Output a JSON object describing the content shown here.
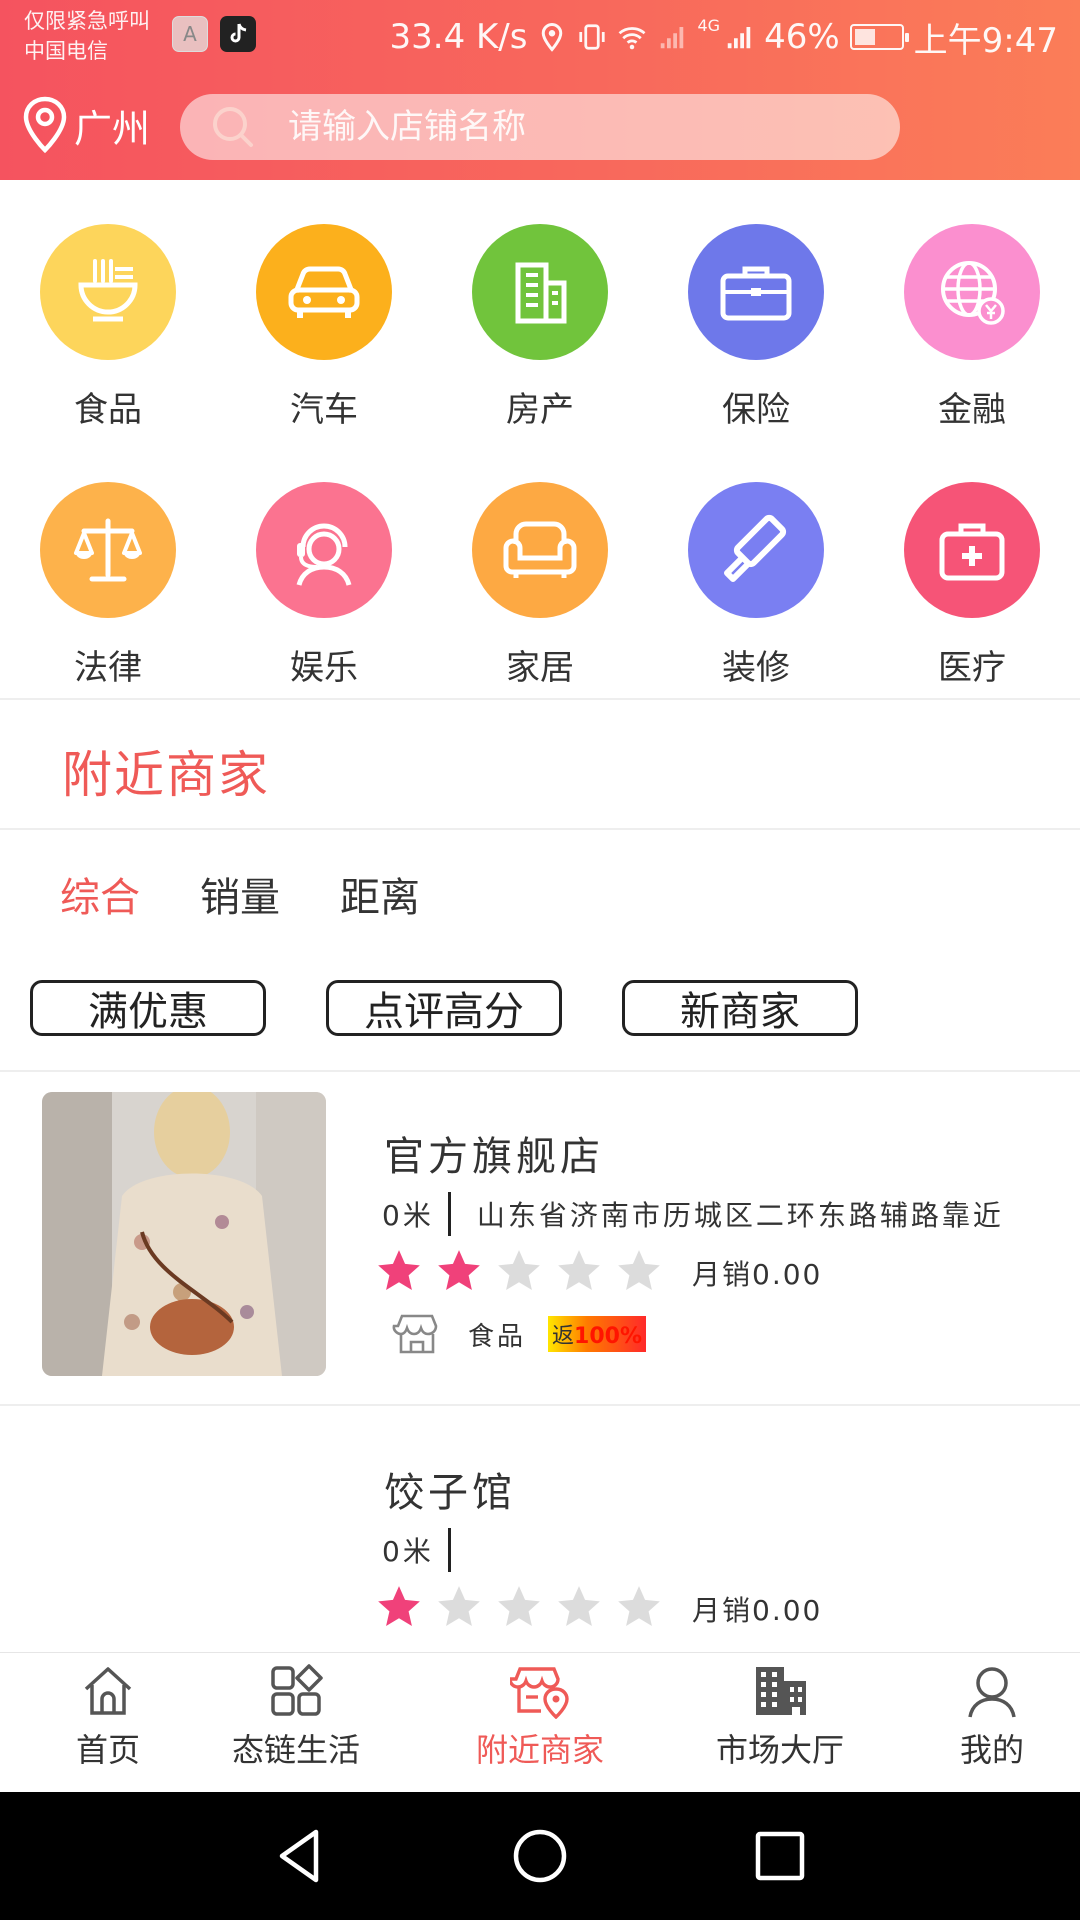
{
  "status_bar": {
    "notice": "仅限紧急呼叫",
    "carrier": "中国电信",
    "app_a": "A",
    "app_tiktok_icon": "tiktok-icon",
    "speed": "33.4 K/s",
    "network": "4G",
    "battery": "46%",
    "battery_level": 0.46,
    "time": "上午9:47"
  },
  "header": {
    "city": "广州",
    "search_placeholder": "请输入店铺名称",
    "gradient": [
      "#f5535f",
      "#fb7d58"
    ]
  },
  "categories": [
    {
      "label": "食品",
      "color": "#fdd55b",
      "icon": "noodle-bowl-icon"
    },
    {
      "label": "汽车",
      "color": "#fcb01c",
      "icon": "car-icon"
    },
    {
      "label": "房产",
      "color": "#71c43c",
      "icon": "building-icon"
    },
    {
      "label": "保险",
      "color": "#6e78ea",
      "icon": "briefcase-icon"
    },
    {
      "label": "金融",
      "color": "#fb8fcf",
      "icon": "globe-yen-icon"
    },
    {
      "label": "法律",
      "color": "#fdb24b",
      "icon": "scales-icon"
    },
    {
      "label": "娱乐",
      "color": "#fb7390",
      "icon": "headset-user-icon"
    },
    {
      "label": "家居",
      "color": "#fda943",
      "icon": "sofa-icon"
    },
    {
      "label": "装修",
      "color": "#7a7ff2",
      "icon": "paint-roller-icon"
    },
    {
      "label": "医疗",
      "color": "#f65477",
      "icon": "medical-kit-icon"
    }
  ],
  "nearby": {
    "title": "附近商家",
    "tabs": [
      {
        "label": "综合",
        "active": true
      },
      {
        "label": "销量",
        "active": false
      },
      {
        "label": "距离",
        "active": false
      }
    ],
    "filters": [
      "满优惠",
      "点评高分",
      "新商家"
    ]
  },
  "merchants": [
    {
      "name": "官方旗舰店",
      "distance": "0米",
      "address": "山东省济南市历城区二环东路辅路靠近",
      "rating": 2,
      "sales": "月销0.00",
      "category": "食品",
      "rebate_prefix": "返",
      "rebate_value": "100%"
    },
    {
      "name": "饺子馆",
      "distance": "0米",
      "address": "",
      "rating": 1,
      "sales": "月销0.00"
    }
  ],
  "bottom_nav": [
    {
      "label": "首页",
      "icon": "home-icon",
      "active": false
    },
    {
      "label": "态链生活",
      "icon": "apps-grid-icon",
      "active": false
    },
    {
      "label": "附近商家",
      "icon": "nearby-shop-icon",
      "active": true
    },
    {
      "label": "市场大厅",
      "icon": "market-building-icon",
      "active": false
    },
    {
      "label": "我的",
      "icon": "user-icon",
      "active": false
    }
  ],
  "colors": {
    "accent": "#ef5a57",
    "star_on": "#f0417a",
    "star_off": "#dcdcdc"
  }
}
